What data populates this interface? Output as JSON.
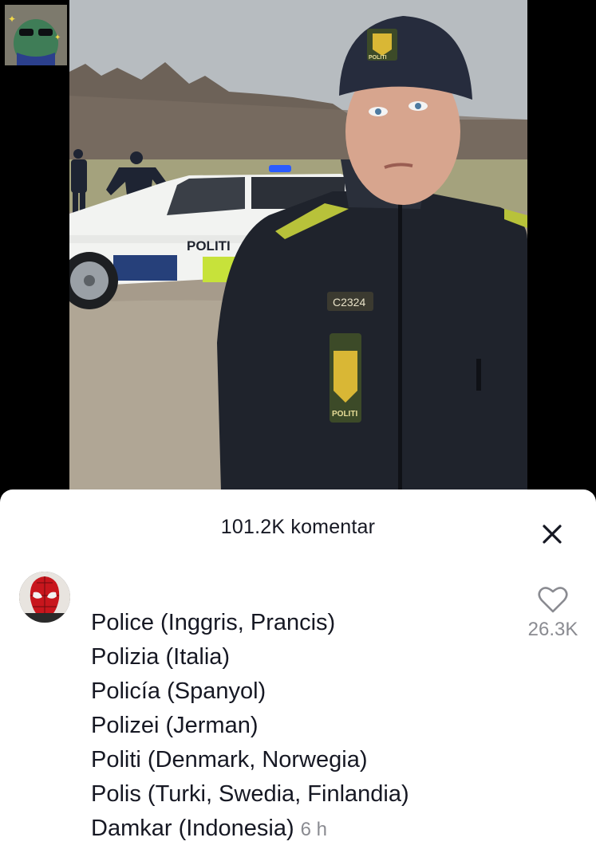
{
  "video": {
    "car_text": "POLITI",
    "badge_text": "C2324",
    "patch_text": "POLITI",
    "hat_text": "POLITI"
  },
  "comments_header": {
    "title": "101.2K komentar"
  },
  "comment": {
    "lines": [
      "Police (Inggris, Prancis)",
      "Polizia (Italia)",
      "Policía (Spanyol)",
      "Polizei (Jerman)",
      "Politi (Denmark, Norwegia)",
      "Polis (Turki, Swedia, Finlandia)",
      "Damkar (Indonesia)"
    ],
    "time": "6 h",
    "likes": "26.3K"
  },
  "colors": {
    "text_primary": "#161823",
    "text_secondary": "#8a8b91",
    "sheet_bg": "#ffffff"
  },
  "icons": {
    "close": "close-icon",
    "like": "heart-outline-icon"
  }
}
